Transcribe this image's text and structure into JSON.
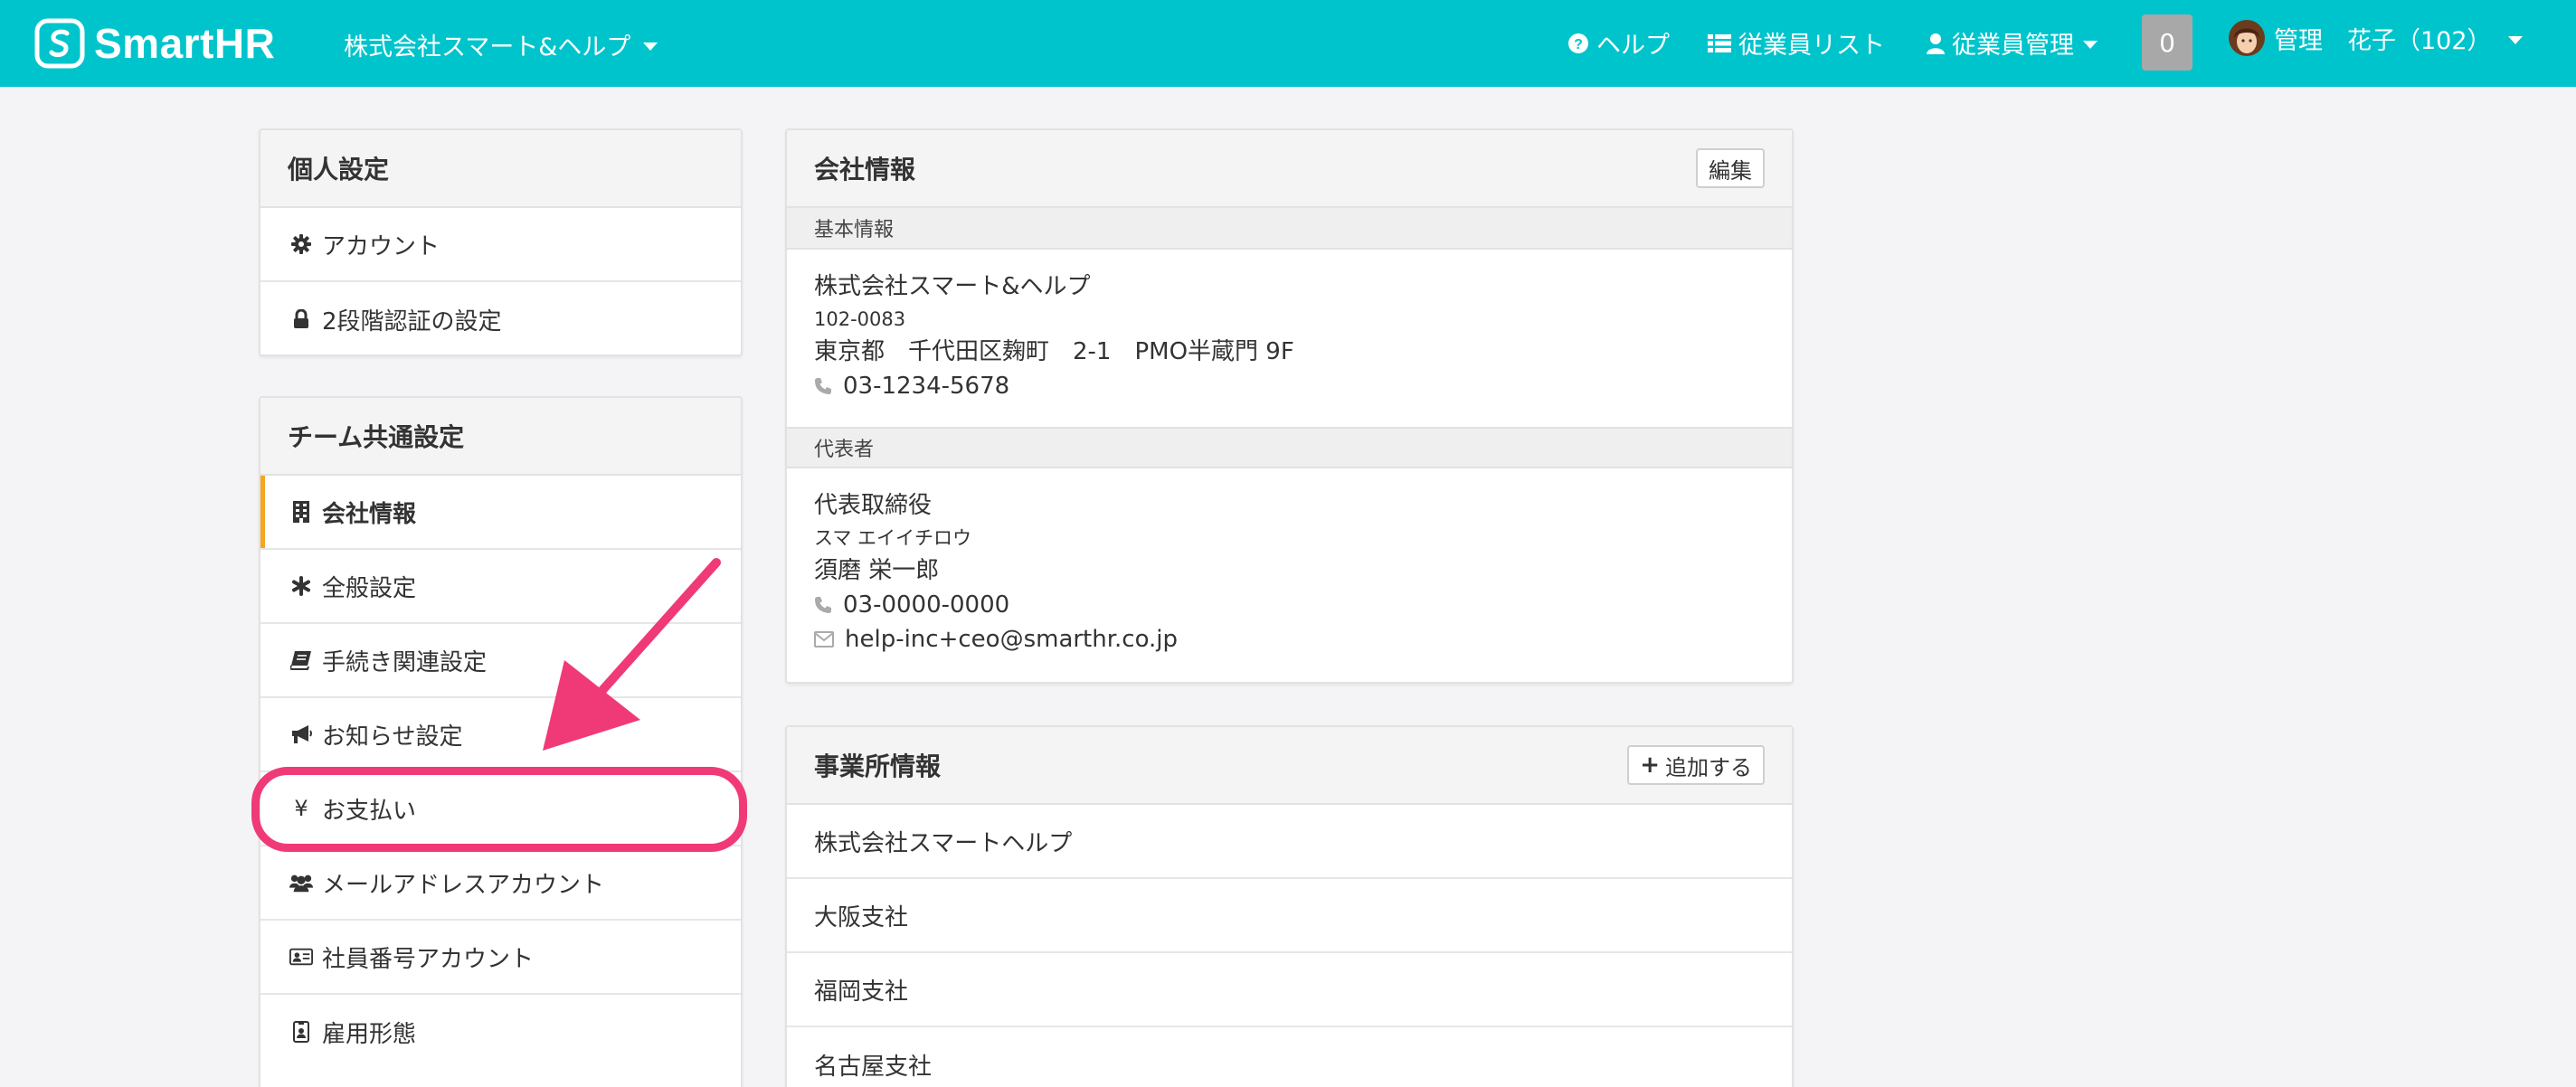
{
  "header": {
    "brand_name": "SmartHR",
    "company_name": "株式会社スマート&ヘルプ",
    "help_label": "ヘルプ",
    "employee_list_label": "従業員リスト",
    "employee_mgmt_label": "従業員管理",
    "notification_count": "0",
    "user_label": "管理　花子（102）",
    "brand_color": "#00c4cc"
  },
  "sidebar": {
    "personal": {
      "title": "個人設定",
      "items": [
        {
          "label": "アカウント",
          "icon": "gear-icon"
        },
        {
          "label": "2段階認証の設定",
          "icon": "lock-icon"
        }
      ]
    },
    "team": {
      "title": "チーム共通設定",
      "items": [
        {
          "label": "会社情報",
          "icon": "building-icon",
          "active": true
        },
        {
          "label": "全般設定",
          "icon": "asterisk-icon"
        },
        {
          "label": "手続き関連設定",
          "icon": "book-icon"
        },
        {
          "label": "お知らせ設定",
          "icon": "megaphone-icon"
        },
        {
          "label": "お支払い",
          "icon": "yen-icon"
        },
        {
          "label": "メールアドレスアカウント",
          "icon": "users-icon"
        },
        {
          "label": "社員番号アカウント",
          "icon": "id-card-icon"
        },
        {
          "label": "雇用形態",
          "icon": "badge-icon"
        }
      ]
    },
    "active_accent": "#f5a623"
  },
  "company_card": {
    "title": "会社情報",
    "edit_label": "編集",
    "basic_heading": "基本情報",
    "company_name": "株式会社スマート&ヘルプ",
    "postal_code": "102-0083",
    "address": "東京都　千代田区麹町　2-1　PMO半蔵門 9F",
    "phone": "03-1234-5678",
    "rep_heading": "代表者",
    "rep_title": "代表取締役",
    "rep_kana": "スマ エイイチロウ",
    "rep_name": "須磨 栄一郎",
    "rep_phone": "03-0000-0000",
    "rep_email": "help-inc+ceo@smarthr.co.jp"
  },
  "office_card": {
    "title": "事業所情報",
    "add_label": "追加する",
    "offices": [
      "株式会社スマートヘルプ",
      "大阪支社",
      "福岡支社",
      "名古屋支社"
    ]
  },
  "annotation": {
    "color": "#f03a78",
    "target": "お支払い"
  }
}
